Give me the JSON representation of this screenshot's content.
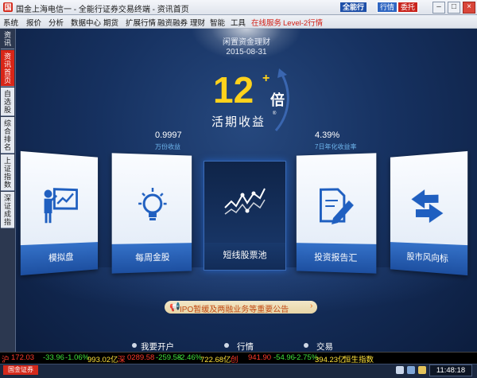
{
  "window": {
    "title": "国金上海电信一 - 全能行证券交易终端 - 资讯首页",
    "app_icon": "国",
    "buttons": {
      "quanneng": "全能行",
      "hangqing": "行情",
      "weituo": "委托"
    },
    "controls": {
      "minimize": "–",
      "maximize": "□",
      "close": "×"
    }
  },
  "menu": [
    "系统",
    "报价",
    "分析",
    "数据中心",
    "期货",
    "扩展行情",
    "融资融券",
    "理财",
    "智能",
    "工具",
    "在线服务",
    "Level-2行情"
  ],
  "sidebar": [
    "资讯",
    "资讯首页",
    "自选股",
    "综合排名",
    "上证指数",
    "深证成指"
  ],
  "promo": {
    "name": "闲置资金理财",
    "date": "2015-08-31",
    "multiplier": "12",
    "plus": "+",
    "unit": "倍",
    "label": "活期收益",
    "mark": "®"
  },
  "stats": {
    "left": {
      "value": "0.9997",
      "label": "万份收益"
    },
    "right": {
      "value": "4.39%",
      "label": "7日年化收益率"
    }
  },
  "cards": [
    {
      "label": "模拟盘",
      "icon": "presenter-chart-icon"
    },
    {
      "label": "每周金股",
      "icon": "lightbulb-icon"
    },
    {
      "label": "短线股票池",
      "icon": "line-chart-icon"
    },
    {
      "label": "投资报告汇",
      "icon": "document-pen-icon"
    },
    {
      "label": "股市风向标",
      "icon": "swap-arrows-icon"
    }
  ],
  "notice": {
    "icon": "megaphone-icon",
    "text": "IPO暂缓及两融业务等重要公告",
    "arrow": "›"
  },
  "bottom_nav": [
    "我要开户",
    "行情",
    "交易"
  ],
  "ticker": {
    "sh_label": "沪",
    "sh_index": "172.03",
    "sh_change": "-33.96",
    "sh_pct": "-1.06%",
    "sh_amount": "993.02亿",
    "sz_label": "深",
    "sz_index": "0289.58",
    "sz_change": "-259.58",
    "sz_pct": "-2.46%",
    "sz_amount": "722.68亿",
    "cy_label": "创",
    "cy_index": "941.90",
    "cy_change": "-54.96",
    "cy_pct": "-2.75%",
    "cy_amount": "394.23亿",
    "hk_label": "恒生指数"
  },
  "status": {
    "broker": "国金证券",
    "time": "11:48:18"
  },
  "colors": {
    "accent_blue": "#1d4fa0",
    "brand_red": "#d42a1c",
    "promo_yellow": "#ffd21c"
  }
}
